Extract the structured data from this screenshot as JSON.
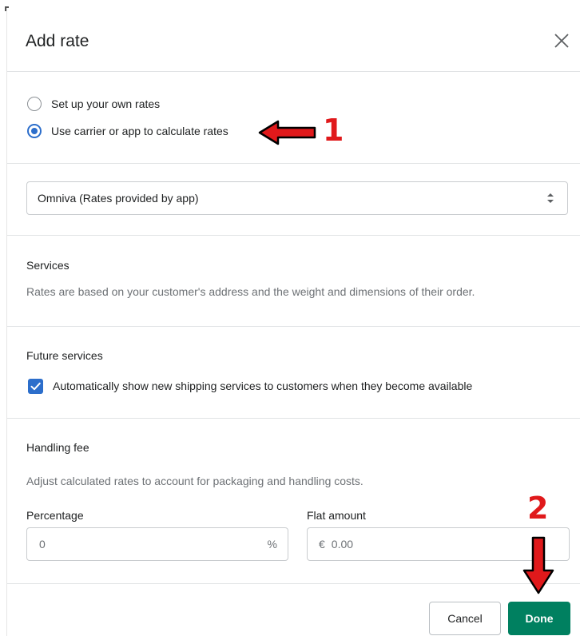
{
  "dialog": {
    "title": "Add rate"
  },
  "rate_type": {
    "options": [
      {
        "label": "Set up your own rates",
        "selected": false
      },
      {
        "label": "Use carrier or app to calculate rates",
        "selected": true
      }
    ]
  },
  "carrier_select": {
    "value": "Omniva (Rates provided by app)"
  },
  "services": {
    "title": "Services",
    "description": "Rates are based on your customer's address and the weight and dimensions of their order."
  },
  "future_services": {
    "title": "Future services",
    "checkbox_label": "Automatically show new shipping services to customers when they become available",
    "checked": true
  },
  "handling_fee": {
    "title": "Handling fee",
    "description": "Adjust calculated rates to account for packaging and handling costs.",
    "percentage_label": "Percentage",
    "percentage_placeholder": "0",
    "percentage_suffix": "%",
    "flat_label": "Flat amount",
    "flat_prefix": "€",
    "flat_placeholder": "0.00"
  },
  "footer": {
    "cancel_label": "Cancel",
    "done_label": "Done"
  },
  "annotations": {
    "step1": "1",
    "step2": "2"
  },
  "colors": {
    "primary": "#008060",
    "selection": "#2c6ecb",
    "annotation": "#e0191b"
  }
}
